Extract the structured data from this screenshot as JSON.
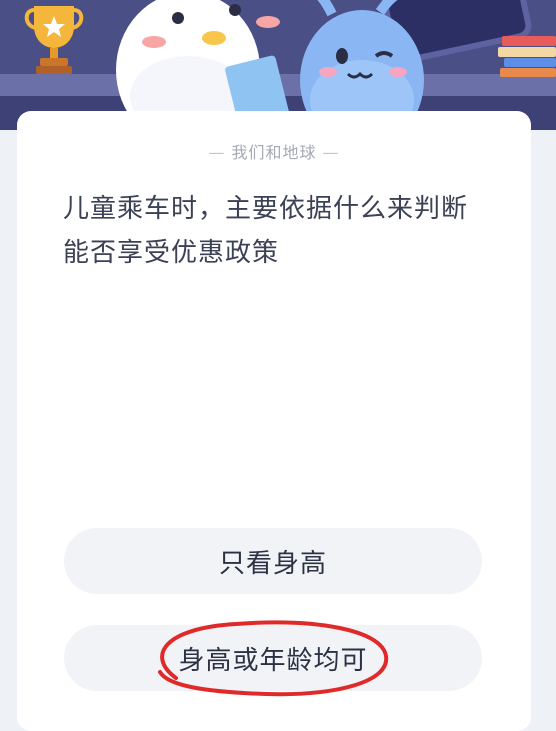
{
  "banner": {
    "trophy_icon": "trophy-icon",
    "books_icon": "books-icon",
    "mascot": "mascot-characters"
  },
  "card": {
    "source": "我们和地球",
    "question": "儿童乘车时，主要依据什么来判断能否享受优惠政策"
  },
  "options": [
    {
      "label": "只看身高"
    },
    {
      "label": "身高或年龄均可"
    }
  ],
  "colors": {
    "banner_bg": "#4a4f86",
    "page_bg": "#eef1f6",
    "option_bg": "#f1f3f6",
    "annotation_red": "#e02a2a"
  }
}
